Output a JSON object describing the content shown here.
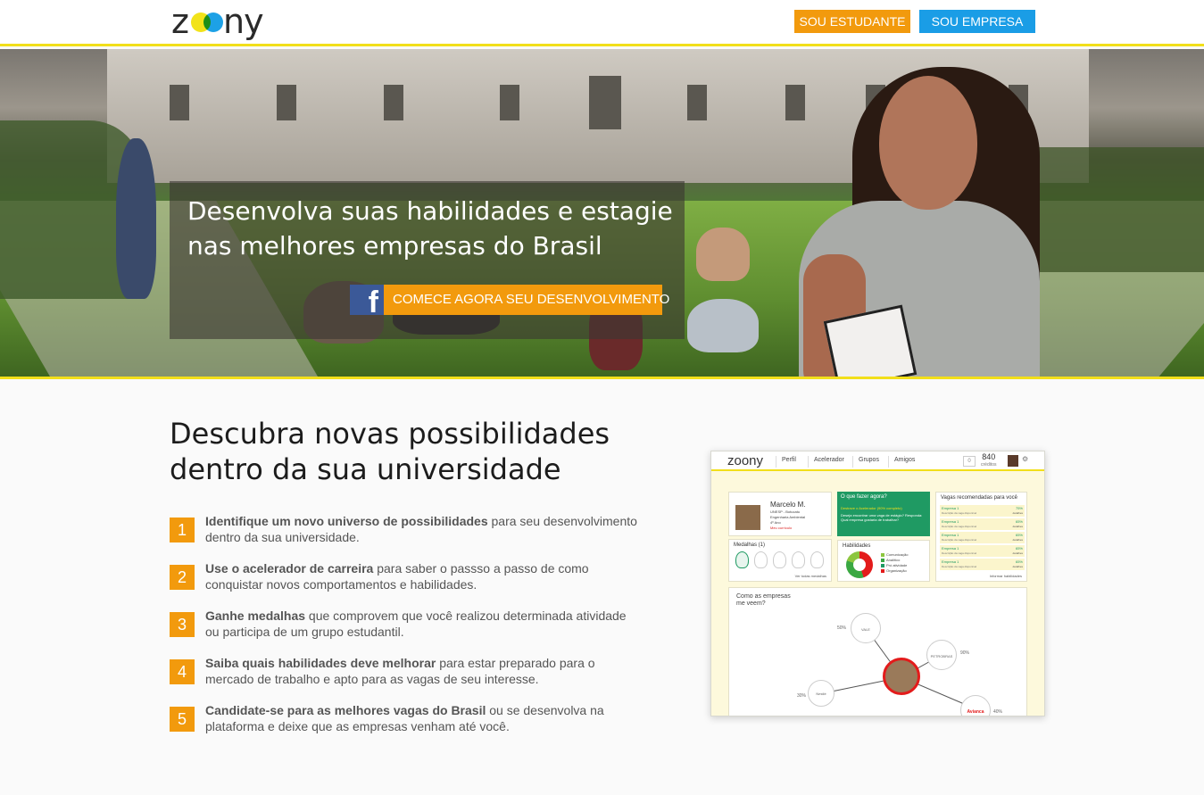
{
  "header": {
    "logo_prefix": "z",
    "logo_suffix": "ny",
    "student_button": "SOU ESTUDANTE",
    "company_button": "SOU EMPRESA"
  },
  "hero": {
    "title": "Desenvolva suas habilidades e estagie nas melhores empresas do Brasil",
    "cta_icon": "f",
    "cta_label": "COMECE AGORA SEU DESENVOLVIMENTO"
  },
  "section": {
    "title": "Descubra novas possibilidades dentro da sua universidade",
    "steps": [
      {
        "num": "1",
        "bold": "Identifique um novo universo de possibilidades",
        "text": " para seu desenvolvimento dentro da sua universidade."
      },
      {
        "num": "2",
        "bold": "Use o acelerador de carreira",
        "text": " para saber o passso a passo de como conquistar novos comportamentos e habilidades."
      },
      {
        "num": "3",
        "bold": "Ganhe medalhas",
        "text": " que comprovem que você realizou determinada atividade ou participa de um grupo estudantil."
      },
      {
        "num": "4",
        "bold": "Saiba quais habilidades deve melhorar",
        "text": " para estar preparado para o mercado de trabalho e apto para as vagas de seu interesse."
      },
      {
        "num": "5",
        "bold": "Candidate-se para as melhores vagas do Brasil",
        "text": " ou se desenvolva na plataforma e deixe que as empresas venham até você."
      }
    ]
  },
  "mock": {
    "logo": "zoony",
    "nav": [
      "Perfil",
      "Acelerador",
      "Grupos",
      "Amigos"
    ],
    "notifications": "0",
    "credits_value": "840",
    "credits_label": "créditos",
    "profile_name": "Marcelo M.",
    "profile_lines": [
      "UNESP - Botucatu",
      "Engenharia Ambiental",
      "4º Ano",
      "Meu currículo"
    ],
    "medals_title": "Medalhas (1)",
    "medals_link": "Ver todas medalhas",
    "action_title": "O que fazer agora?",
    "action_status": "Destrave o Acelerador (90% completo)",
    "action_text": "Deseja encontrar uma vaga de estágio? Responda: Qual empresa gostaria de trabalhar?",
    "skills_title": "Habilidades",
    "skills_legend": [
      "Comunicação",
      "Analítico",
      "Pró atividade",
      "Organização"
    ],
    "skills_colors": [
      "#8cc63f",
      "#3aa842",
      "#1f9a63",
      "#e31b1b"
    ],
    "vagas_title": "Vagas recomendadas para você",
    "vagas": [
      {
        "name": "Empresa 1",
        "desc": "Descrição da vaga disponível",
        "pct": "75%",
        "detail": "detalhes"
      },
      {
        "name": "Empresa 1",
        "desc": "Descrição da vaga disponível",
        "pct": "65%",
        "detail": "detalhes"
      },
      {
        "name": "Empresa 1",
        "desc": "Descrição da vaga disponível",
        "pct": "65%",
        "detail": "detalhes"
      },
      {
        "name": "Empresa 1",
        "desc": "Descrição da vaga disponível",
        "pct": "65%",
        "detail": "detalhes"
      },
      {
        "name": "Empresa 1",
        "desc": "Descrição da vaga disponível",
        "pct": "65%",
        "detail": "detalhes"
      }
    ],
    "vagas_link": "Informar habilidades",
    "empresas_title": "Como as empresas me veem?",
    "companies": [
      {
        "brand": "VALE",
        "pct": "50%"
      },
      {
        "brand": "PETROBRAS",
        "pct": "90%"
      },
      {
        "brand": "Nestlé",
        "pct": "30%"
      },
      {
        "brand": "Avianca",
        "pct": "40%"
      }
    ]
  },
  "colors": {
    "accent_yellow": "#f2df1a",
    "orange": "#f29a0d",
    "blue": "#1a9de6",
    "facebook": "#3b5998"
  }
}
